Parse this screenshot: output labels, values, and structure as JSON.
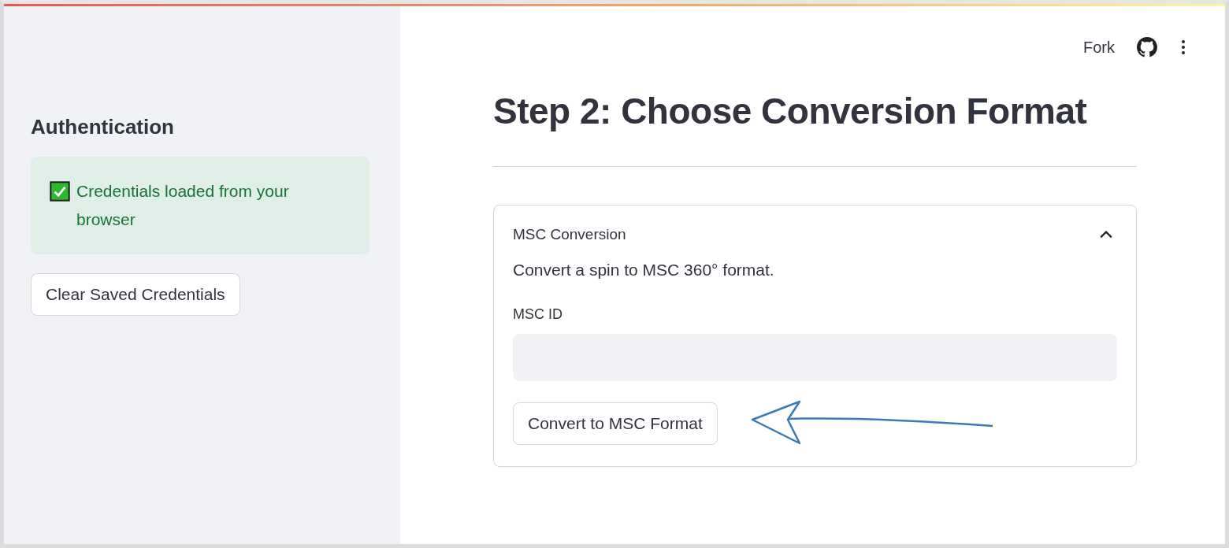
{
  "sidebar": {
    "heading": "Authentication",
    "alert": {
      "kind": "success",
      "text": "Credentials loaded from your browser"
    },
    "button": "Clear Saved Credentials"
  },
  "header": {
    "fork_label": "Fork"
  },
  "main": {
    "title": "Step 2: Choose Conversion Format",
    "expander": {
      "title": "MSC Conversion",
      "expanded": true,
      "description": "Convert a spin to MSC 360° format.",
      "field": {
        "label": "MSC ID"
      },
      "button": "Convert to MSC Format"
    }
  }
}
